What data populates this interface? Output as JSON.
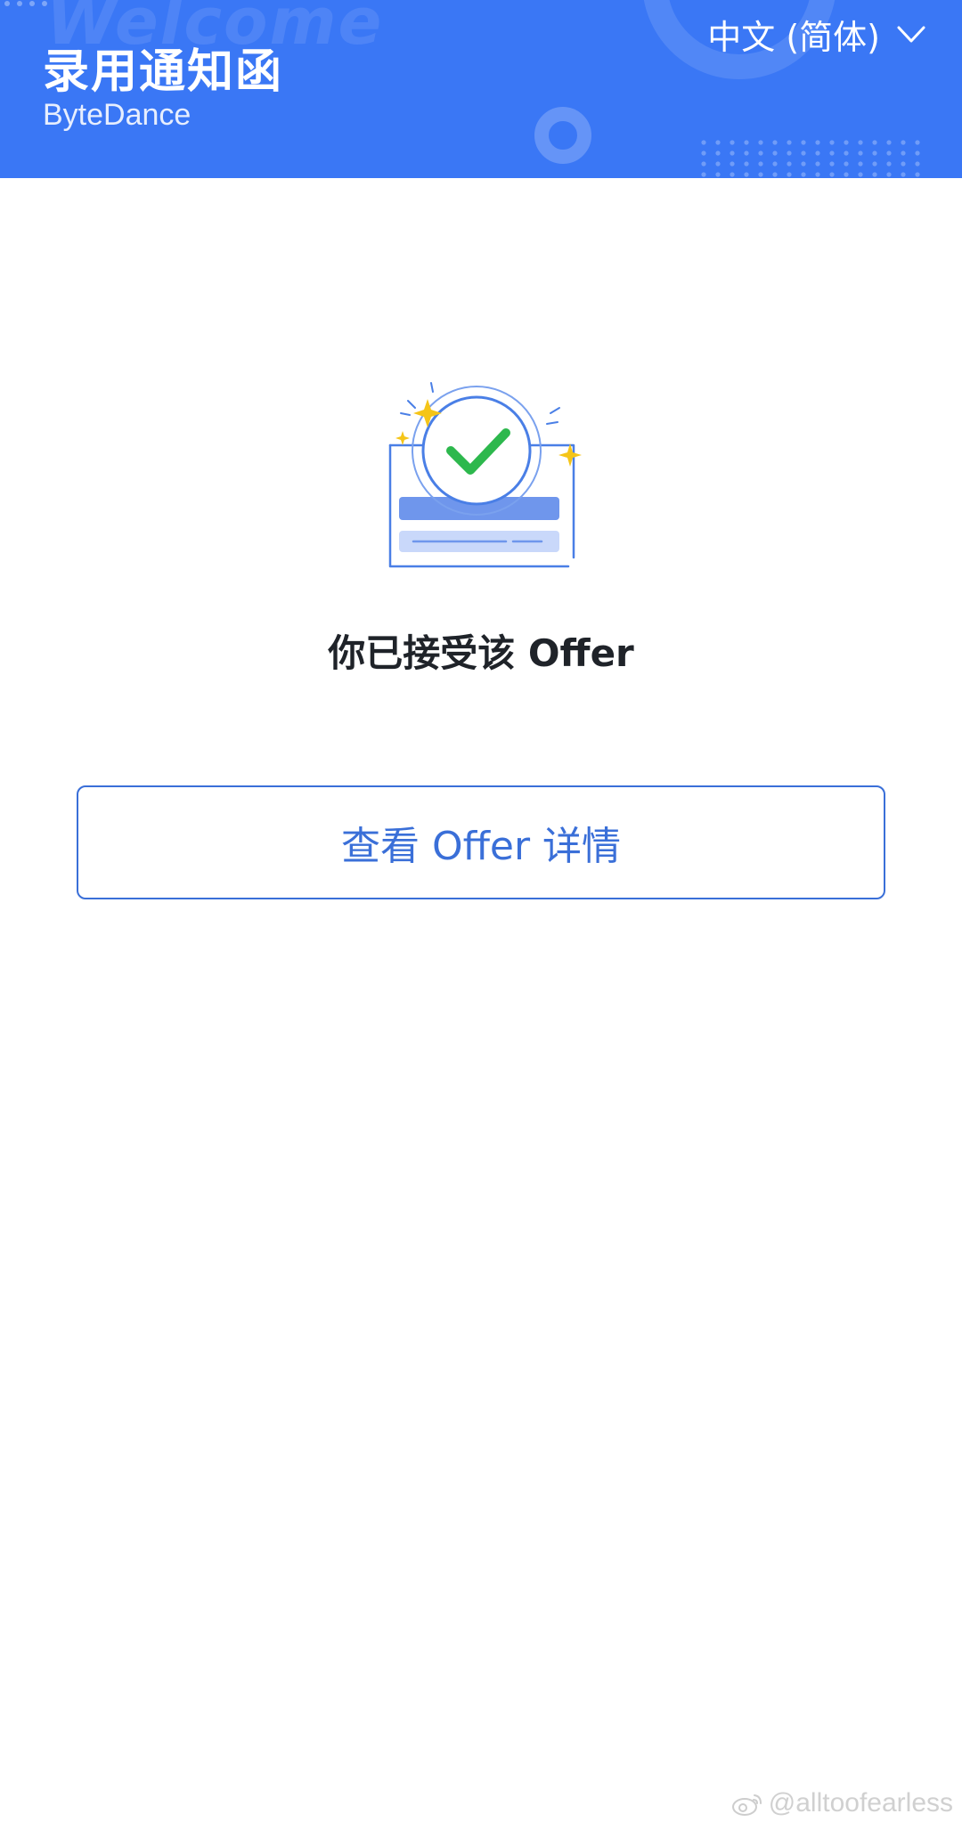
{
  "header": {
    "title": "录用通知函",
    "subtitle": "ByteDance",
    "watermark_word": "Welcome",
    "background_color": "#3a77f5",
    "language": {
      "label": "中文 (简体)",
      "icon": "chevron-down-icon"
    }
  },
  "main": {
    "illustration_icon": "offer-accepted-check-icon",
    "status_text": "你已接受该 Offer",
    "view_button_label": "查看 Offer 详情",
    "accent_color": "#3a6fd8",
    "check_color": "#2db84d",
    "sparkle_color": "#f5c518"
  },
  "watermark": {
    "text": "@alltoofearless",
    "icon": "weibo-icon"
  }
}
